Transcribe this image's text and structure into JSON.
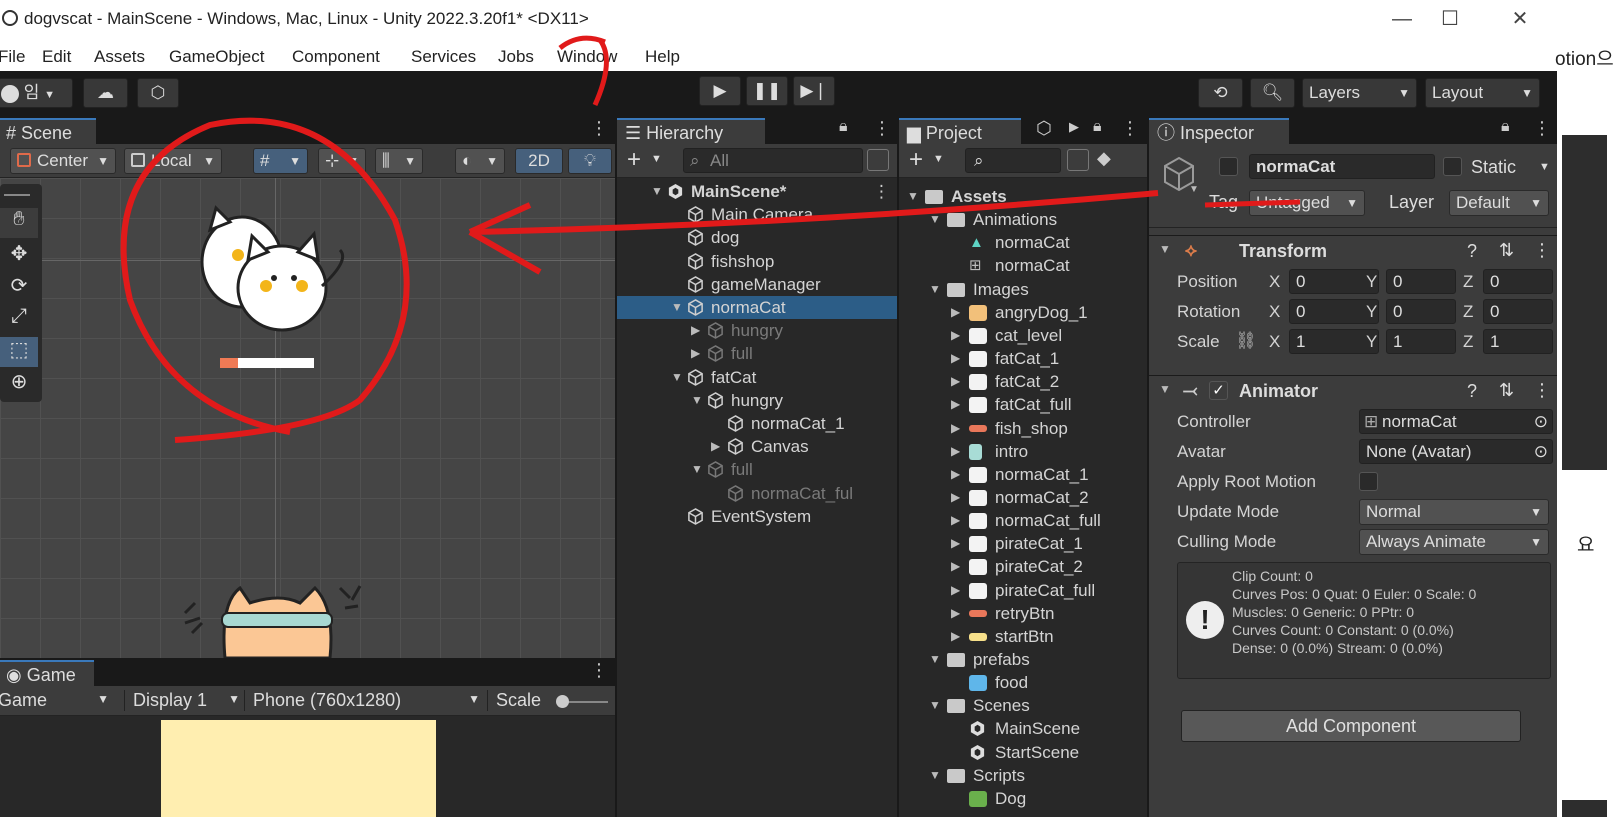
{
  "window": {
    "title": "dogvscat - MainScene - Windows, Mac, Linux - Unity 2022.3.20f1* <DX11>",
    "minimize": "—",
    "maximize": "☐",
    "close": "✕"
  },
  "menu": [
    "File",
    "Edit",
    "Assets",
    "GameObject",
    "Component",
    "Services",
    "Jobs",
    "Window",
    "Help"
  ],
  "toolbar": {
    "account_label": "임",
    "layers_label": "Layers",
    "layout_label": "Layout"
  },
  "scene": {
    "tab_label": "Scene",
    "pivot_label": "Center",
    "space_label": "Local",
    "mode_2d": "2D"
  },
  "game": {
    "tab_label": "Game",
    "view_label": "Game",
    "display_label": "Display 1",
    "resolution_label": "Phone (760x1280)",
    "scale_label": "Scale"
  },
  "hierarchy": {
    "tab_label": "Hierarchy",
    "search_placeholder": "All",
    "items": [
      {
        "label": "MainScene*",
        "depth": 0,
        "arrow": "▼",
        "kind": "scene",
        "state": "bold"
      },
      {
        "label": "Main Camera",
        "depth": 1,
        "arrow": "",
        "kind": "cube",
        "state": "normal"
      },
      {
        "label": "dog",
        "depth": 1,
        "arrow": "",
        "kind": "cube",
        "state": "normal"
      },
      {
        "label": "fishshop",
        "depth": 1,
        "arrow": "",
        "kind": "cube",
        "state": "normal"
      },
      {
        "label": "gameManager",
        "depth": 1,
        "arrow": "",
        "kind": "cube",
        "state": "normal"
      },
      {
        "label": "normaCat",
        "depth": 1,
        "arrow": "▼",
        "kind": "cube",
        "state": "selected"
      },
      {
        "label": "hungry",
        "depth": 2,
        "arrow": "▶",
        "kind": "cube",
        "state": "dim"
      },
      {
        "label": "full",
        "depth": 2,
        "arrow": "▶",
        "kind": "cube",
        "state": "dim"
      },
      {
        "label": "fatCat",
        "depth": 1,
        "arrow": "▼",
        "kind": "cube",
        "state": "normal"
      },
      {
        "label": "hungry",
        "depth": 2,
        "arrow": "▼",
        "kind": "cube",
        "state": "normal"
      },
      {
        "label": "normaCat_1",
        "depth": 3,
        "arrow": "",
        "kind": "cube",
        "state": "normal"
      },
      {
        "label": "Canvas",
        "depth": 3,
        "arrow": "▶",
        "kind": "cube",
        "state": "normal"
      },
      {
        "label": "full",
        "depth": 2,
        "arrow": "▼",
        "kind": "cube",
        "state": "dim"
      },
      {
        "label": "normaCat_ful",
        "depth": 3,
        "arrow": "",
        "kind": "cube",
        "state": "dim"
      },
      {
        "label": "EventSystem",
        "depth": 1,
        "arrow": "",
        "kind": "cube",
        "state": "normal"
      }
    ]
  },
  "project": {
    "tab_label": "Project",
    "items": [
      {
        "label": "Assets",
        "depth": 0,
        "arrow": "▼",
        "kind": "folder",
        "bold": true
      },
      {
        "label": "Animations",
        "depth": 1,
        "arrow": "▼",
        "kind": "folder"
      },
      {
        "label": "normaCat",
        "depth": 2,
        "arrow": "",
        "kind": "anim"
      },
      {
        "label": "normaCat",
        "depth": 2,
        "arrow": "",
        "kind": "controller"
      },
      {
        "label": "Images",
        "depth": 1,
        "arrow": "▼",
        "kind": "folder"
      },
      {
        "label": "angryDog_1",
        "depth": 2,
        "arrow": "▶",
        "kind": "sprite-dog"
      },
      {
        "label": "cat_level",
        "depth": 2,
        "arrow": "▶",
        "kind": "sprite-white"
      },
      {
        "label": "fatCat_1",
        "depth": 2,
        "arrow": "▶",
        "kind": "sprite-white"
      },
      {
        "label": "fatCat_2",
        "depth": 2,
        "arrow": "▶",
        "kind": "sprite-white"
      },
      {
        "label": "fatCat_full",
        "depth": 2,
        "arrow": "▶",
        "kind": "sprite-white"
      },
      {
        "label": "fish_shop",
        "depth": 2,
        "arrow": "▶",
        "kind": "sprite-orange"
      },
      {
        "label": "intro",
        "depth": 2,
        "arrow": "▶",
        "kind": "sprite-intro"
      },
      {
        "label": "normaCat_1",
        "depth": 2,
        "arrow": "▶",
        "kind": "sprite-white"
      },
      {
        "label": "normaCat_2",
        "depth": 2,
        "arrow": "▶",
        "kind": "sprite-white"
      },
      {
        "label": "normaCat_full",
        "depth": 2,
        "arrow": "▶",
        "kind": "sprite-white"
      },
      {
        "label": "pirateCat_1",
        "depth": 2,
        "arrow": "▶",
        "kind": "sprite-white"
      },
      {
        "label": "pirateCat_2",
        "depth": 2,
        "arrow": "▶",
        "kind": "sprite-white"
      },
      {
        "label": "pirateCat_full",
        "depth": 2,
        "arrow": "▶",
        "kind": "sprite-white"
      },
      {
        "label": "retryBtn",
        "depth": 2,
        "arrow": "▶",
        "kind": "sprite-orange"
      },
      {
        "label": "startBtn",
        "depth": 2,
        "arrow": "▶",
        "kind": "sprite-yellow"
      },
      {
        "label": "prefabs",
        "depth": 1,
        "arrow": "▼",
        "kind": "folder"
      },
      {
        "label": "food",
        "depth": 2,
        "arrow": "",
        "kind": "prefab"
      },
      {
        "label": "Scenes",
        "depth": 1,
        "arrow": "▼",
        "kind": "folder"
      },
      {
        "label": "MainScene",
        "depth": 2,
        "arrow": "",
        "kind": "scene"
      },
      {
        "label": "StartScene",
        "depth": 2,
        "arrow": "",
        "kind": "scene"
      },
      {
        "label": "Scripts",
        "depth": 1,
        "arrow": "▼",
        "kind": "folder"
      },
      {
        "label": "Dog",
        "depth": 2,
        "arrow": "",
        "kind": "script"
      }
    ]
  },
  "inspector": {
    "tab_label": "Inspector",
    "object_name": "normaCat",
    "static_label": "Static",
    "tag_label": "Tag",
    "tag_value": "Untagged",
    "layer_label": "Layer",
    "layer_value": "Default",
    "transform": {
      "title": "Transform",
      "position_label": "Position",
      "rotation_label": "Rotation",
      "scale_label": "Scale",
      "position": {
        "x": "0",
        "y": "0",
        "z": "0"
      },
      "rotation": {
        "x": "0",
        "y": "0",
        "z": "0"
      },
      "scale": {
        "x": "1",
        "y": "1",
        "z": "1"
      }
    },
    "animator": {
      "title": "Animator",
      "controller_label": "Controller",
      "controller_value": "normaCat",
      "avatar_label": "Avatar",
      "avatar_value": "None (Avatar)",
      "apply_root_motion_label": "Apply Root Motion",
      "update_mode_label": "Update Mode",
      "update_mode_value": "Normal",
      "culling_mode_label": "Culling Mode",
      "culling_mode_value": "Always Animate",
      "info_lines": [
        "Clip Count: 0",
        "Curves Pos: 0 Quat: 0 Euler: 0 Scale: 0",
        "Muscles: 0 Generic: 0 PPtr: 0",
        "Curves Count: 0 Constant: 0 (0.0%)",
        "Dense: 0 (0.0%) Stream: 0 (0.0%)"
      ]
    },
    "add_component_label": "Add Component"
  },
  "background_right": {
    "text_top": "otion으",
    "text_mid": "요"
  },
  "colors": {
    "editor_bg": "#282828",
    "selection": "#2c5d87",
    "annotation_red": "#e11a1a",
    "game_view_bg": "#ffeeb0"
  }
}
